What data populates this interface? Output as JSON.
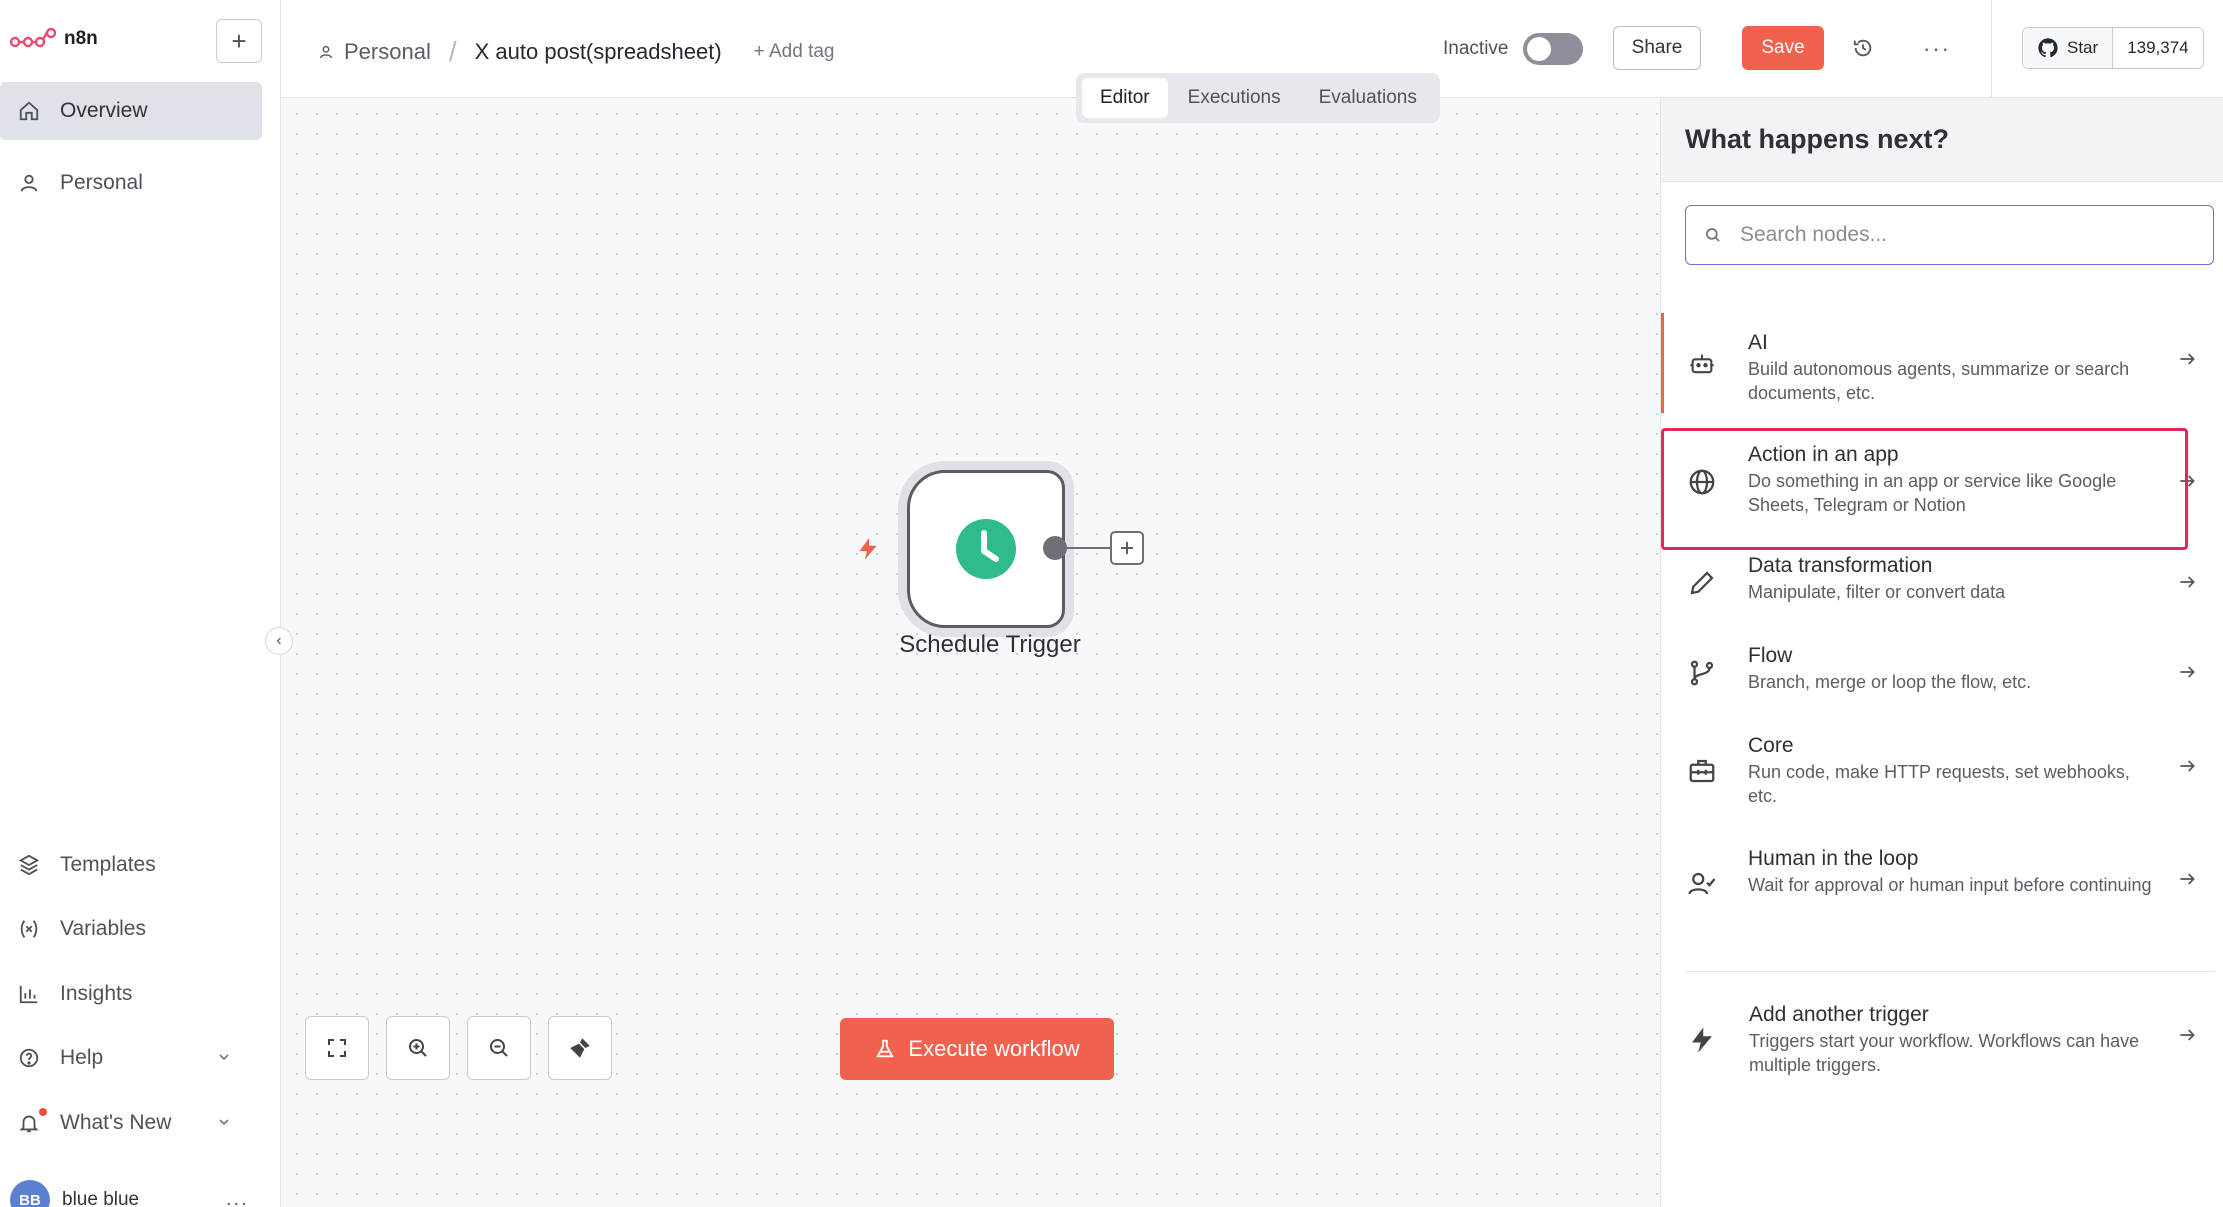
{
  "sidebar": {
    "logo_text": "n8n",
    "new_button": "+",
    "nav_top": [
      {
        "label": "Overview",
        "icon": "home-icon",
        "active": true
      },
      {
        "label": "Personal",
        "icon": "user-icon",
        "active": false
      }
    ],
    "nav_bottom": [
      {
        "label": "Templates",
        "icon": "box-icon"
      },
      {
        "label": "Variables",
        "icon": "variables-icon"
      },
      {
        "label": "Insights",
        "icon": "chart-icon"
      },
      {
        "label": "Help",
        "icon": "help-icon"
      },
      {
        "label": "What's New",
        "icon": "bell-icon"
      }
    ],
    "user": {
      "initials": "BB",
      "name": "blue blue",
      "more": "..."
    }
  },
  "header": {
    "breadcrumb_project": "Personal",
    "breadcrumb_sep": "/",
    "workflow_name": "X auto post(spreadsheet)",
    "add_tag": "+ Add tag",
    "inactive_label": "Inactive",
    "share_label": "Share",
    "save_label": "Save",
    "more_label": "···",
    "github": {
      "star_label": "Star",
      "count": "139,374"
    }
  },
  "tabs": [
    {
      "label": "Editor",
      "active": true
    },
    {
      "label": "Executions",
      "active": false
    },
    {
      "label": "Evaluations",
      "active": false
    }
  ],
  "canvas": {
    "node_label": "Schedule Trigger",
    "execute_label": "Execute workflow"
  },
  "panel": {
    "title": "What happens next?",
    "search_placeholder": "Search nodes...",
    "categories": [
      {
        "title": "AI",
        "desc": "Build autonomous agents, summarize or search documents, etc.",
        "icon": "robot-icon"
      },
      {
        "title": "Action in an app",
        "desc": "Do something in an app or service like Google Sheets, Telegram or Notion",
        "icon": "globe-icon"
      },
      {
        "title": "Data transformation",
        "desc": "Manipulate, filter or convert data",
        "icon": "pen-icon"
      },
      {
        "title": "Flow",
        "desc": "Branch, merge or loop the flow, etc.",
        "icon": "branch-icon"
      },
      {
        "title": "Core",
        "desc": "Run code, make HTTP requests, set webhooks, etc.",
        "icon": "toolbox-icon"
      },
      {
        "title": "Human in the loop",
        "desc": "Wait for approval or human input before continuing",
        "icon": "user-check-icon"
      }
    ],
    "trigger": {
      "title": "Add another trigger",
      "desc": "Triggers start your workflow. Workflows can have multiple triggers.",
      "icon": "bolt-icon"
    }
  },
  "colors": {
    "accent": "#f0624e",
    "node_green": "#2fbb8d",
    "highlight": "#e5265a"
  }
}
